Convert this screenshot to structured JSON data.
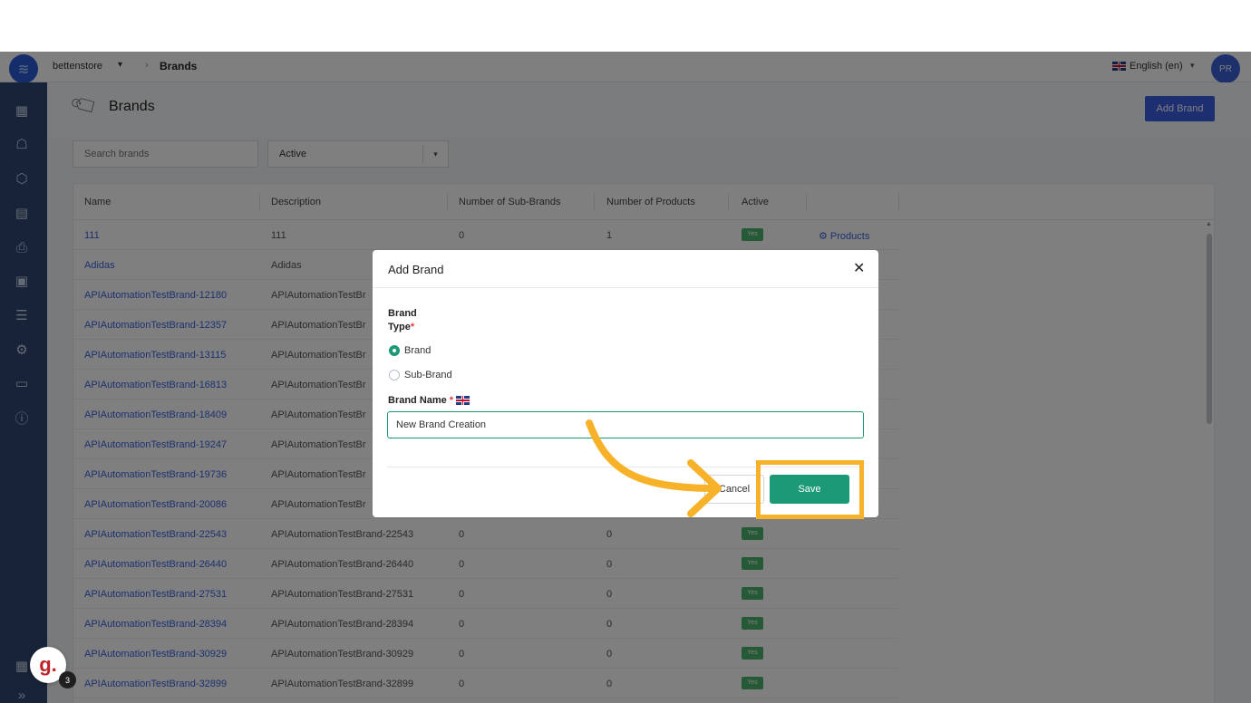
{
  "topbar": {
    "store_name": "bettenstore",
    "breadcrumb_current": "Brands",
    "language": "English (en)",
    "avatar_initials": "PR"
  },
  "header": {
    "title": "Brands",
    "add_button": "Add Brand"
  },
  "filters": {
    "search_placeholder": "Search brands",
    "status_value": "Active"
  },
  "table": {
    "columns": [
      "Name",
      "Description",
      "Number of Sub-Brands",
      "Number of Products",
      "Active"
    ],
    "rows": [
      {
        "name": "111",
        "description": "111",
        "sub_brands": "0",
        "products": "1",
        "active": "Yes",
        "link": "Products"
      },
      {
        "name": "Adidas",
        "description": "Adidas",
        "sub_brands": "",
        "products": "",
        "active": "",
        "link": ""
      },
      {
        "name": "APIAutomationTestBrand-12180",
        "description": "APIAutomationTestBr",
        "sub_brands": "",
        "products": "",
        "active": "",
        "link": ""
      },
      {
        "name": "APIAutomationTestBrand-12357",
        "description": "APIAutomationTestBr",
        "sub_brands": "",
        "products": "",
        "active": "",
        "link": ""
      },
      {
        "name": "APIAutomationTestBrand-13115",
        "description": "APIAutomationTestBr",
        "sub_brands": "",
        "products": "",
        "active": "",
        "link": ""
      },
      {
        "name": "APIAutomationTestBrand-16813",
        "description": "APIAutomationTestBr",
        "sub_brands": "",
        "products": "",
        "active": "",
        "link": ""
      },
      {
        "name": "APIAutomationTestBrand-18409",
        "description": "APIAutomationTestBr",
        "sub_brands": "",
        "products": "",
        "active": "",
        "link": ""
      },
      {
        "name": "APIAutomationTestBrand-19247",
        "description": "APIAutomationTestBr",
        "sub_brands": "",
        "products": "",
        "active": "",
        "link": ""
      },
      {
        "name": "APIAutomationTestBrand-19736",
        "description": "APIAutomationTestBr",
        "sub_brands": "",
        "products": "",
        "active": "",
        "link": ""
      },
      {
        "name": "APIAutomationTestBrand-20086",
        "description": "APIAutomationTestBr",
        "sub_brands": "",
        "products": "",
        "active": "",
        "link": ""
      },
      {
        "name": "APIAutomationTestBrand-22543",
        "description": "APIAutomationTestBrand-22543",
        "sub_brands": "0",
        "products": "0",
        "active": "Yes",
        "link": ""
      },
      {
        "name": "APIAutomationTestBrand-26440",
        "description": "APIAutomationTestBrand-26440",
        "sub_brands": "0",
        "products": "0",
        "active": "Yes",
        "link": ""
      },
      {
        "name": "APIAutomationTestBrand-27531",
        "description": "APIAutomationTestBrand-27531",
        "sub_brands": "0",
        "products": "0",
        "active": "Yes",
        "link": ""
      },
      {
        "name": "APIAutomationTestBrand-28394",
        "description": "APIAutomationTestBrand-28394",
        "sub_brands": "0",
        "products": "0",
        "active": "Yes",
        "link": ""
      },
      {
        "name": "APIAutomationTestBrand-30929",
        "description": "APIAutomationTestBrand-30929",
        "sub_brands": "0",
        "products": "0",
        "active": "Yes",
        "link": ""
      },
      {
        "name": "APIAutomationTestBrand-32899",
        "description": "APIAutomationTestBrand-32899",
        "sub_brands": "0",
        "products": "0",
        "active": "Yes",
        "link": ""
      }
    ]
  },
  "modal": {
    "title": "Add Brand",
    "brand_type_label": "Brand Type",
    "required_mark": "*",
    "options": [
      "Brand",
      "Sub-Brand"
    ],
    "selected_option": "Brand",
    "brand_name_label": "Brand Name",
    "brand_name_value": "New Brand Creation",
    "cancel_label": "Cancel",
    "save_label": "Save"
  },
  "widget": {
    "letter": "g.",
    "badge_count": "3"
  },
  "colors": {
    "sidebar": "#2f4671",
    "primary": "#3b5fe0",
    "save": "#1c9a78",
    "highlight": "#f7b22a"
  },
  "icons": {
    "sidebar": [
      "dashboard-icon",
      "users-icon",
      "box-icon",
      "catalog-icon",
      "printer-icon",
      "folder-icon",
      "list-icon",
      "settings-icon",
      "monitor-icon",
      "help-icon",
      "apps-icon",
      "expand-icon"
    ]
  }
}
